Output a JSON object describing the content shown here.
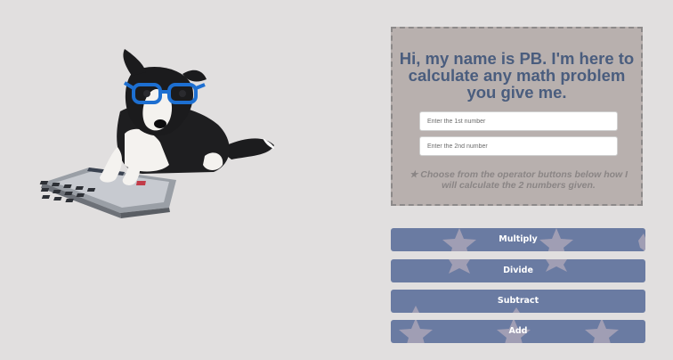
{
  "mascot": {
    "name": "dog-with-calculator"
  },
  "panel": {
    "heading": "Hi, my name is PB. I'm here to calculate any math problem you give me.",
    "first_input_placeholder": "Enter the 1st number",
    "second_input_placeholder": "Enter the 2nd number",
    "first_input_value": "",
    "second_input_value": "",
    "instructions": "★ Choose from the operator buttons below how I will calculate the 2 numbers given."
  },
  "operators": {
    "multiply_label": "Multiply",
    "divide_label": "Divide",
    "subtract_label": "Subtract",
    "add_label": "Add"
  },
  "colors": {
    "background": "#e1dfdf",
    "panel": "#b8b0ae",
    "heading": "#4a5d7e",
    "button": "#6a7ba2",
    "star": "#b3aaba"
  },
  "icons": {
    "button_decoration": "star-icon"
  }
}
